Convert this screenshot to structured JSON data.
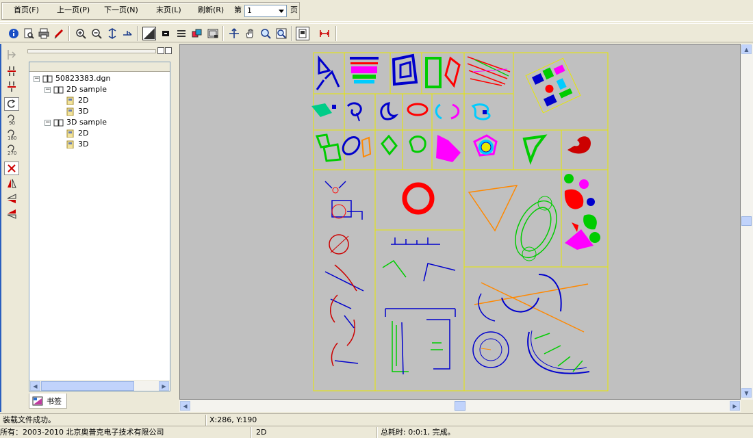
{
  "menu": {
    "first": "首页(F)",
    "prev": "上一页(P)",
    "next": "下一页(N)",
    "last": "末页(L)",
    "refresh": "刷新(R)",
    "page_prefix": "第",
    "page_value": "1",
    "page_suffix": "页"
  },
  "toolbar": {
    "icons": [
      "info-icon",
      "print-preview-icon",
      "print-icon",
      "pen-icon",
      "zoom-in-icon",
      "zoom-out-icon",
      "fit-icon",
      "pan-arrow-icon",
      "contrast-icon",
      "black-square-icon",
      "layers-icon",
      "3d-cube-icon",
      "view-window-icon",
      "move-icon",
      "hand-icon",
      "zoom-window-icon",
      "zoom-search-icon",
      "page-view-icon",
      "measure-icon"
    ]
  },
  "left_tools": {
    "icons": [
      "rotate-tool-icon",
      "flip-vertical-icon",
      "flip-horizontal-icon",
      "rotate-undo-icon",
      "rotate-90-icon",
      "rotate-180-icon",
      "rotate-270-icon",
      "clear-rotate-icon",
      "mirror-a-icon",
      "mirror-b-icon",
      "mirror-c-icon"
    ]
  },
  "tree": {
    "root": "50823383.dgn",
    "nodes": [
      {
        "label": "2D sample",
        "children": [
          "2D",
          "3D"
        ]
      },
      {
        "label": "3D sample",
        "children": [
          "2D",
          "3D"
        ]
      }
    ]
  },
  "panel_tab": "书签",
  "status": {
    "message": "装载文件成功。",
    "coords": "X:286, Y:190",
    "copyright": "所有：2003-2010 北京奥普克电子技术有限公司",
    "mode": "2D",
    "elapsed": "总耗时: 0:0:1, 完成。"
  },
  "colors": {
    "frame_border": "#e8e800",
    "canvas_bg": "#c0c0c0",
    "paper_bg": "#c8c8c8"
  }
}
